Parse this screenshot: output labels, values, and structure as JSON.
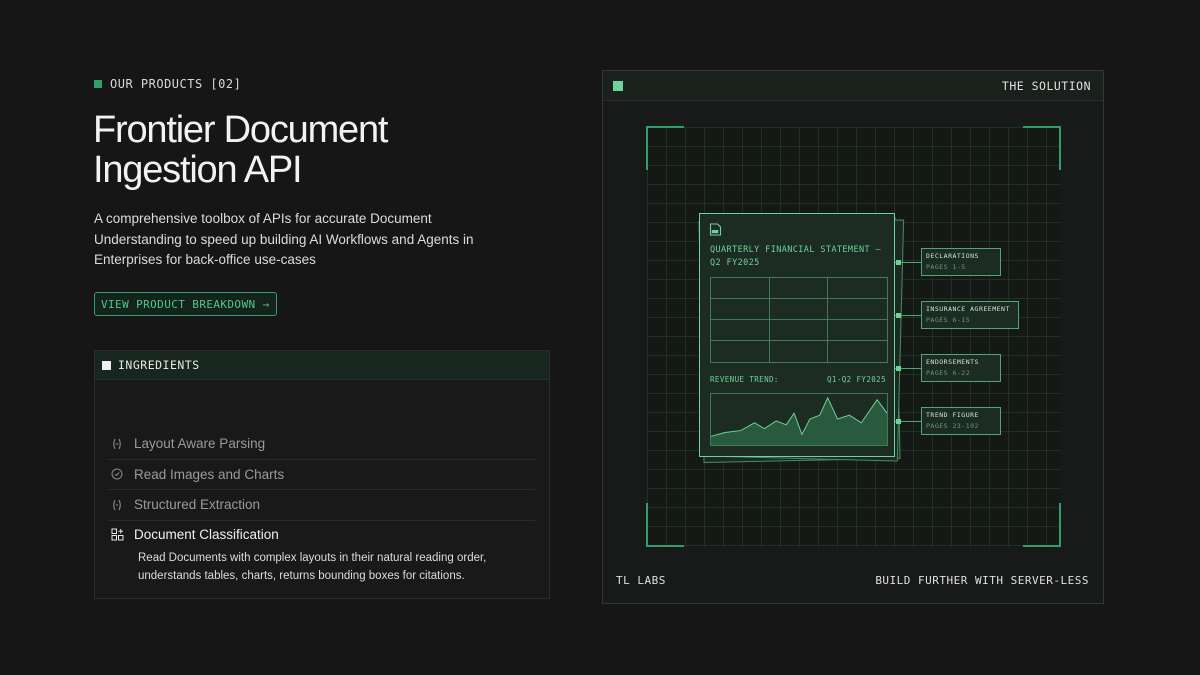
{
  "eyebrow": "OUR PRODUCTS [02]",
  "title": "Frontier Document Ingestion API",
  "description": "A comprehensive toolbox of APIs for accurate Document Understanding to speed up building AI Workflows and Agents in Enterprises for back-office use-cases",
  "cta_label": "VIEW PRODUCT BREAKDOWN →",
  "ingredients": {
    "header": "INGREDIENTS",
    "items": [
      {
        "label": "Layout Aware Parsing",
        "icon": "parse-icon"
      },
      {
        "label": "Read Images and Charts",
        "icon": "check-circle-icon"
      },
      {
        "label": "Structured Extraction",
        "icon": "brackets-icon"
      },
      {
        "label": "Document Classification",
        "icon": "grid-plus-icon"
      }
    ],
    "active_description": "Read Documents with complex layouts in their natural reading order, understands tables, charts, returns bounding boxes for citations."
  },
  "card": {
    "header": "THE SOLUTION",
    "footer_left": "TL LABS",
    "footer_right": "BUILD FURTHER WITH SERVER-LESS",
    "doc_title": "QUARTERLY FINANCIAL STATEMENT — Q2 FY2025",
    "revenue_label": "REVENUE TREND:",
    "revenue_range": "Q1-Q2 FY2025",
    "sections": [
      {
        "name": "DECLARATIONS",
        "pages": "PAGES 1-5"
      },
      {
        "name": "INSURANCE AGREEMENT",
        "pages": "PAGES 6-15"
      },
      {
        "name": "ENDORSEMENTS",
        "pages": "PAGES 6-22"
      },
      {
        "name": "TREND FIGURE",
        "pages": "PAGES 23-102"
      }
    ]
  },
  "colors": {
    "accent": "#2f9e6a",
    "accent_light": "#6fd29a",
    "background": "#161616"
  }
}
